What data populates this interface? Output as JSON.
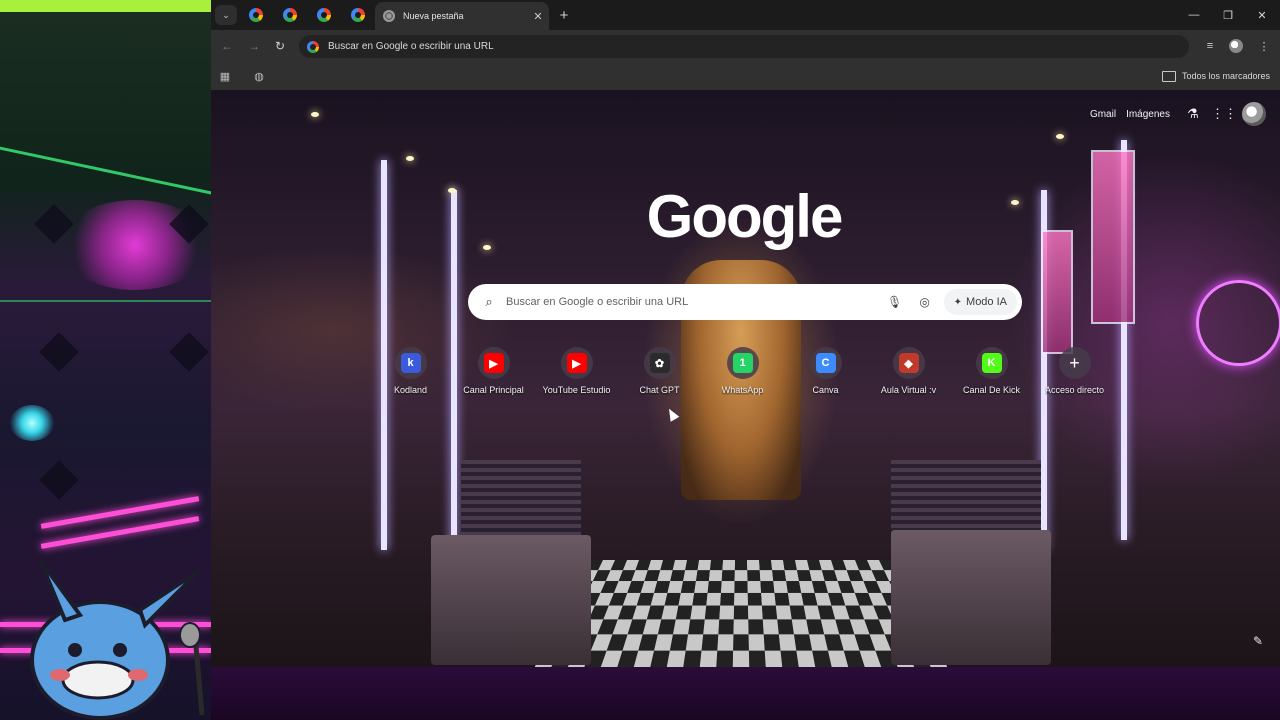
{
  "tabs": {
    "active_title": "Nueva pestaña",
    "background_count": 4
  },
  "toolbar": {
    "omnibox_text": "Buscar en Google o escribir una URL"
  },
  "bookmarks": {
    "all_bookmarks_label": "Todos los marcadores"
  },
  "ntp": {
    "gmail_label": "Gmail",
    "images_label": "Imágenes",
    "logo_text": "Google",
    "search_placeholder": "Buscar en Google o escribir una URL",
    "ai_mode_label": "Modo IA",
    "shortcuts": [
      {
        "label": "Kodland",
        "icon": "kodland-icon",
        "color": "#3b5bdb",
        "glyph": "k"
      },
      {
        "label": "Canal Principal",
        "icon": "youtube-icon",
        "color": "#ff0000",
        "glyph": "▶"
      },
      {
        "label": "YouTube Estudio",
        "icon": "youtube-icon",
        "color": "#ff0000",
        "glyph": "▶"
      },
      {
        "label": "Chat GPT",
        "icon": "chatgpt-icon",
        "color": "#2b2b2b",
        "glyph": "✿"
      },
      {
        "label": "WhatsApp",
        "icon": "whatsapp-icon",
        "color": "#25d366",
        "glyph": "1"
      },
      {
        "label": "Canva",
        "icon": "canva-icon",
        "color": "#3d8bfd",
        "glyph": "C"
      },
      {
        "label": "Aula Virtual :v",
        "icon": "aula-virtual-icon",
        "color": "#c0392b",
        "glyph": "◆"
      },
      {
        "label": "Canal De Kick",
        "icon": "kick-icon",
        "color": "#53fc18",
        "glyph": "K"
      },
      {
        "label": "Acceso directo",
        "icon": "add-icon",
        "color": "transparent",
        "glyph": "+"
      }
    ]
  }
}
